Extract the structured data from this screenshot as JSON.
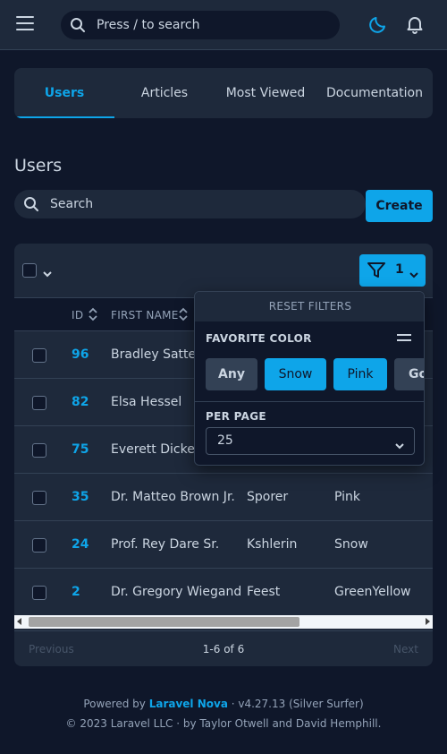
{
  "topbar": {
    "menu_icon": "hamburger-menu-icon",
    "search_placeholder": "Press / to search",
    "theme_icon": "moon-icon",
    "notifications_icon": "bell-icon"
  },
  "tabs": [
    {
      "label": "Users",
      "active": true
    },
    {
      "label": "Articles",
      "active": false
    },
    {
      "label": "Most Viewed",
      "active": false
    },
    {
      "label": "Documentation",
      "active": false
    }
  ],
  "page": {
    "title": "Users",
    "search_placeholder": "Search",
    "create_label": "Create"
  },
  "table": {
    "filter_count": "1",
    "headers": {
      "id": "ID",
      "first_name": "FIRST NAME"
    },
    "rows": [
      {
        "id": "96",
        "first_name": "Bradley Satterfield",
        "last_name": "",
        "color": ""
      },
      {
        "id": "82",
        "first_name": "Elsa Hessel",
        "last_name": "",
        "color": ""
      },
      {
        "id": "75",
        "first_name": "Everett Dickens",
        "last_name": "",
        "color": ""
      },
      {
        "id": "35",
        "first_name": "Dr. Matteo Brown Jr.",
        "last_name": "Sporer",
        "color": "Pink"
      },
      {
        "id": "24",
        "first_name": "Prof. Rey Dare Sr.",
        "last_name": "Kshlerin",
        "color": "Snow"
      },
      {
        "id": "2",
        "first_name": "Dr. Gregory Wiegand",
        "last_name": "Feest",
        "color": "GreenYellow"
      }
    ],
    "pagination": {
      "previous": "Previous",
      "info": "1-6 of 6",
      "next": "Next"
    }
  },
  "filter_panel": {
    "reset_label": "RESET FILTERS",
    "favorite_color_label": "FAVORITE COLOR",
    "options": [
      {
        "label": "Any",
        "selected": false
      },
      {
        "label": "Snow",
        "selected": true
      },
      {
        "label": "Pink",
        "selected": true
      },
      {
        "label": "Go",
        "selected": false
      }
    ],
    "per_page_label": "PER PAGE",
    "per_page_value": "25"
  },
  "footer": {
    "powered_prefix": "Powered by ",
    "powered_link": "Laravel Nova",
    "version": " · v4.27.13 (Silver Surfer)",
    "copyright": "© 2023 Laravel LLC · by Taylor Otwell and David Hemphill."
  },
  "colors": {
    "accent": "#0ea5e9",
    "background": "#0f172a",
    "surface": "#1e293b"
  }
}
